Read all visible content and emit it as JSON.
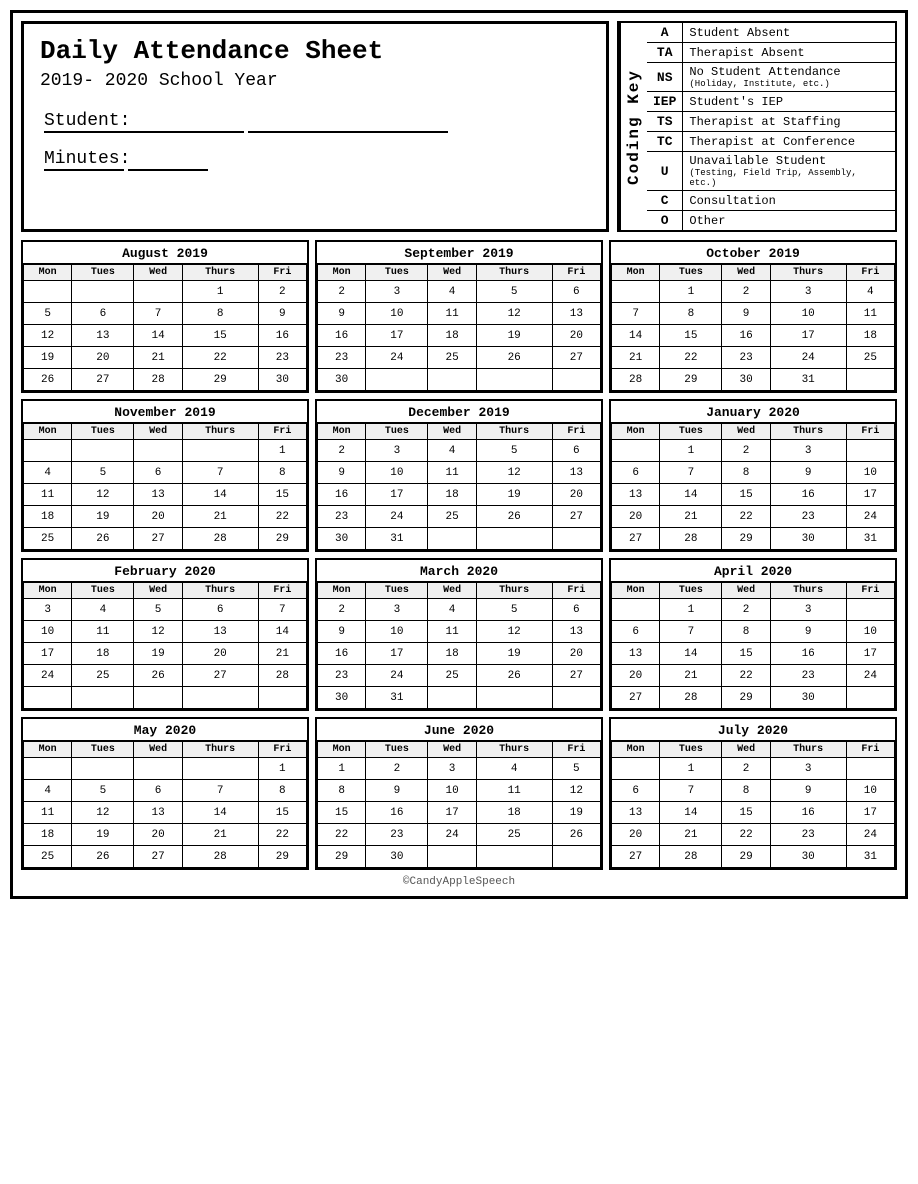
{
  "header": {
    "title": "Daily Attendance Sheet",
    "year": "2019- 2020 School Year",
    "student_label": "Student:",
    "minutes_label": "Minutes:"
  },
  "coding_key": {
    "label": "Coding Key",
    "items": [
      {
        "code": "A",
        "description": "Student Absent",
        "sub": ""
      },
      {
        "code": "TA",
        "description": "Therapist Absent",
        "sub": ""
      },
      {
        "code": "NS",
        "description": "No Student Attendance",
        "sub": "(Holiday, Institute, etc.)"
      },
      {
        "code": "IEP",
        "description": "Student's IEP",
        "sub": ""
      },
      {
        "code": "TS",
        "description": "Therapist at Staffing",
        "sub": ""
      },
      {
        "code": "TC",
        "description": "Therapist at Conference",
        "sub": ""
      },
      {
        "code": "U",
        "description": "Unavailable Student",
        "sub": "(Testing, Field Trip, Assembly, etc.)"
      },
      {
        "code": "C",
        "description": "Consultation",
        "sub": ""
      },
      {
        "code": "O",
        "description": "Other",
        "sub": ""
      }
    ]
  },
  "calendars": [
    {
      "month": "August 2019",
      "days": [
        [
          "",
          "",
          "",
          "1",
          "2"
        ],
        [
          "5",
          "6",
          "7",
          "8",
          "9"
        ],
        [
          "12",
          "13",
          "14",
          "15",
          "16"
        ],
        [
          "19",
          "20",
          "21",
          "22",
          "23"
        ],
        [
          "26",
          "27",
          "28",
          "29",
          "30"
        ]
      ]
    },
    {
      "month": "September 2019",
      "days": [
        [
          "2",
          "3",
          "4",
          "5",
          "6"
        ],
        [
          "9",
          "10",
          "11",
          "12",
          "13"
        ],
        [
          "16",
          "17",
          "18",
          "19",
          "20"
        ],
        [
          "23",
          "24",
          "25",
          "26",
          "27"
        ],
        [
          "30",
          "",
          "",
          "",
          ""
        ]
      ]
    },
    {
      "month": "October 2019",
      "days": [
        [
          "",
          "1",
          "2",
          "3",
          "4"
        ],
        [
          "7",
          "8",
          "9",
          "10",
          "11"
        ],
        [
          "14",
          "15",
          "16",
          "17",
          "18"
        ],
        [
          "21",
          "22",
          "23",
          "24",
          "25"
        ],
        [
          "28",
          "29",
          "30",
          "31",
          ""
        ]
      ]
    },
    {
      "month": "November 2019",
      "days": [
        [
          "",
          "",
          "",
          "",
          "1"
        ],
        [
          "4",
          "5",
          "6",
          "7",
          "8"
        ],
        [
          "11",
          "12",
          "13",
          "14",
          "15"
        ],
        [
          "18",
          "19",
          "20",
          "21",
          "22"
        ],
        [
          "25",
          "26",
          "27",
          "28",
          "29"
        ]
      ]
    },
    {
      "month": "December 2019",
      "days": [
        [
          "2",
          "3",
          "4",
          "5",
          "6"
        ],
        [
          "9",
          "10",
          "11",
          "12",
          "13"
        ],
        [
          "16",
          "17",
          "18",
          "19",
          "20"
        ],
        [
          "23",
          "24",
          "25",
          "26",
          "27"
        ],
        [
          "30",
          "31",
          "",
          "",
          ""
        ]
      ]
    },
    {
      "month": "January 2020",
      "days": [
        [
          "",
          "1",
          "2",
          "3",
          ""
        ],
        [
          "6",
          "7",
          "8",
          "9",
          "10"
        ],
        [
          "13",
          "14",
          "15",
          "16",
          "17"
        ],
        [
          "20",
          "21",
          "22",
          "23",
          "24"
        ],
        [
          "27",
          "28",
          "29",
          "30",
          "31"
        ]
      ]
    },
    {
      "month": "February 2020",
      "days": [
        [
          "3",
          "4",
          "5",
          "6",
          "7"
        ],
        [
          "10",
          "11",
          "12",
          "13",
          "14"
        ],
        [
          "17",
          "18",
          "19",
          "20",
          "21"
        ],
        [
          "24",
          "25",
          "26",
          "27",
          "28"
        ],
        [
          "",
          "",
          "",
          "",
          ""
        ]
      ]
    },
    {
      "month": "March 2020",
      "days": [
        [
          "2",
          "3",
          "4",
          "5",
          "6"
        ],
        [
          "9",
          "10",
          "11",
          "12",
          "13"
        ],
        [
          "16",
          "17",
          "18",
          "19",
          "20"
        ],
        [
          "23",
          "24",
          "25",
          "26",
          "27"
        ],
        [
          "30",
          "31",
          "",
          "",
          ""
        ]
      ]
    },
    {
      "month": "April 2020",
      "days": [
        [
          "",
          "1",
          "2",
          "3",
          ""
        ],
        [
          "6",
          "7",
          "8",
          "9",
          "10"
        ],
        [
          "13",
          "14",
          "15",
          "16",
          "17"
        ],
        [
          "20",
          "21",
          "22",
          "23",
          "24"
        ],
        [
          "27",
          "28",
          "29",
          "30",
          ""
        ]
      ]
    },
    {
      "month": "May 2020",
      "days": [
        [
          "",
          "",
          "",
          "",
          "1"
        ],
        [
          "4",
          "5",
          "6",
          "7",
          "8"
        ],
        [
          "11",
          "12",
          "13",
          "14",
          "15"
        ],
        [
          "18",
          "19",
          "20",
          "21",
          "22"
        ],
        [
          "25",
          "26",
          "27",
          "28",
          "29"
        ]
      ]
    },
    {
      "month": "June 2020",
      "days": [
        [
          "1",
          "2",
          "3",
          "4",
          "5"
        ],
        [
          "8",
          "9",
          "10",
          "11",
          "12"
        ],
        [
          "15",
          "16",
          "17",
          "18",
          "19"
        ],
        [
          "22",
          "23",
          "24",
          "25",
          "26"
        ],
        [
          "29",
          "30",
          "",
          "",
          ""
        ]
      ]
    },
    {
      "month": "July 2020",
      "days": [
        [
          "",
          "1",
          "2",
          "3",
          ""
        ],
        [
          "6",
          "7",
          "8",
          "9",
          "10"
        ],
        [
          "13",
          "14",
          "15",
          "16",
          "17"
        ],
        [
          "20",
          "21",
          "22",
          "23",
          "24"
        ],
        [
          "27",
          "28",
          "29",
          "30",
          "31"
        ]
      ]
    }
  ],
  "days_header": [
    "Mon",
    "Tues",
    "Wed",
    "Thurs",
    "Fri"
  ],
  "footer": "©CandyAppleSpeech"
}
